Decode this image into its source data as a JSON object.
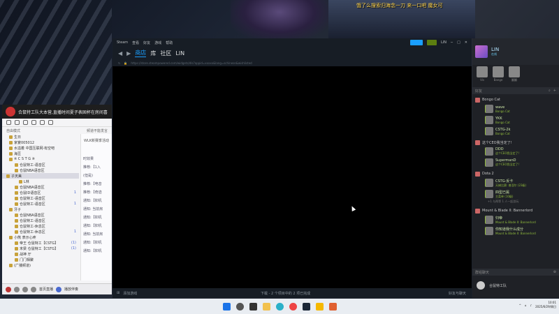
{
  "overlay": {
    "text": "饿了么搜索归海念一刀 来一口吧 魔女可"
  },
  "yy": {
    "title": "合鼠特工队大本营,直播时间夏子表固杯在房间喜",
    "mode": "自由模式",
    "notice_label": "频道不能发言",
    "top_label": "WLK新赛季活动",
    "tree": [
      {
        "label": "生日",
        "num": "",
        "kind": "ch"
      },
      {
        "label": "家宴005012",
        "num": "",
        "kind": "ch"
      },
      {
        "label": "水溢着 中国互联网·有空吧",
        "num": "",
        "kind": "ch"
      },
      {
        "label": "海豆",
        "num": "",
        "kind": "ch"
      },
      {
        "label": "※  C  S  T  G  ※",
        "num": "",
        "kind": "ch"
      },
      {
        "label": "仓鼠特工-语音区",
        "num": "",
        "kind": "sub"
      },
      {
        "label": "仓鼠NBA语音区",
        "num": "",
        "kind": "sub"
      },
      {
        "label": "子天美",
        "num": "",
        "kind": "sel"
      },
      {
        "label": "L林",
        "num": "",
        "kind": "user"
      },
      {
        "label": "仓鼠NBA语音区",
        "num": "",
        "kind": "sub"
      },
      {
        "label": "仓鼠ID语音区",
        "num": "1",
        "kind": "sub"
      },
      {
        "label": "仓鼠特工-语音区",
        "num": "",
        "kind": "sub"
      },
      {
        "label": "仓鼠特工-语音区",
        "num": "1",
        "kind": "sub"
      },
      {
        "label": "牙子",
        "num": "",
        "kind": "ch"
      },
      {
        "label": "仓鼠NBA语音区",
        "num": "",
        "kind": "sub"
      },
      {
        "label": "仓鼠特工-语音区",
        "num": "",
        "kind": "sub"
      },
      {
        "label": "仓鼠特工-休息区",
        "num": "",
        "kind": "sub"
      },
      {
        "label": "仓鼠特工-休息区",
        "num": "1",
        "kind": "sub"
      },
      {
        "label": "小熊 表示心疼",
        "num": "",
        "kind": "ch"
      },
      {
        "label": "帝王 仓鼠特工【CSTG】",
        "num": "(1)",
        "kind": "sub"
      },
      {
        "label": "末梁 仓鼠特工【CSTG】",
        "num": "(1)",
        "kind": "sub"
      },
      {
        "label": "战神 厅",
        "num": "",
        "kind": "sub"
      },
      {
        "label": "门门相聚",
        "num": "",
        "kind": "sub"
      },
      {
        "label": "(广播频道)",
        "num": "",
        "kind": "ch"
      }
    ],
    "chat": [
      "时效果",
      "推荐:【1入",
      "(但是)",
      "推荐:【电音",
      "推荐:【奇迹",
      "通知:【抑机",
      "通知: 当前房",
      "通知:【抑机",
      "通知:【抑机",
      "通知: 当前房",
      "通知:【抑机",
      "通知:【抑机"
    ],
    "foot": {
      "hall": "首页直播",
      "play": "播放伴奏"
    }
  },
  "steam": {
    "menu": [
      "Steam",
      "查看",
      "好友",
      "游戏",
      "帮助"
    ],
    "user": "LIN",
    "tabs": [
      "商店",
      "库",
      "社区",
      "LIN"
    ],
    "url": "https://store.steampowered.com/widgets/dls?appid=xxxxx&lang=schinese&wishlisted",
    "bottom": {
      "add": "添加游戏",
      "download": "下载 - 2 个项目中的 2 项已完成",
      "friends": "好友与聊天"
    }
  },
  "friends": {
    "me": {
      "name": "LIN",
      "status": "在线"
    },
    "recent": [
      {
        "name": "Vis"
      },
      {
        "name": "Bange"
      },
      {
        "name": "翻翻"
      }
    ],
    "header": "好友",
    "groups": [
      {
        "title": "Bongo Cat",
        "members": [
          {
            "name": "wave",
            "game": "Bongo Cat"
          },
          {
            "name": "YKK",
            "game": "Bongo Cat"
          },
          {
            "name": "CSTG-2k",
            "game": "Bongo Cat"
          }
        ]
      },
      {
        "title": "这个CEO我当定了!",
        "members": [
          {
            "name": "DDD",
            "game": "这个CEO我当定了!"
          },
          {
            "name": "SupermanD",
            "game": "这个CEO我当定了!"
          }
        ]
      },
      {
        "title": "Dota 2",
        "members": [
          {
            "name": "CSTG-反卡",
            "game": "天梯比赛: 普涅尔 (23级)"
          },
          {
            "name": "四型已属",
            "game": "主菜单 (10级)"
          }
        ],
        "more": "+1 与两等 1 人一起游玩"
      },
      {
        "title": "Mount & Blade II: Bannerlord",
        "members": [
          {
            "name": "归帝",
            "game": "Mount & Blade II: Bannerlord"
          },
          {
            "name": "你知道我什么成分",
            "game": "Mount & Blade II: Bannerlord"
          }
        ]
      }
    ],
    "chats_header": "群组聊天",
    "guild": "合鼠特工队"
  },
  "taskbar": {
    "time": "10:01",
    "date": "2025/6/29/周日"
  }
}
